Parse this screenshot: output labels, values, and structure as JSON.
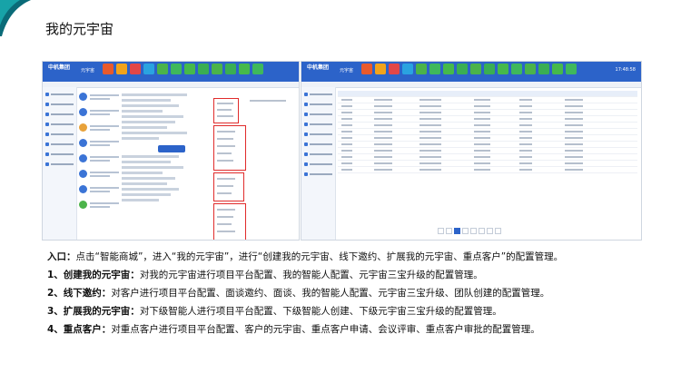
{
  "colors": {
    "topbar": "#2c63c9",
    "highlight": "#e02b2b",
    "accent": "#0a6b78"
  },
  "page": {
    "title": "我的元宇宙"
  },
  "screenshots": {
    "left": {
      "brand": "中机集团",
      "brand_small": "",
      "brand_sub": "元宇宙",
      "time": ""
    },
    "right": {
      "brand": "中机集团",
      "brand_small": "",
      "brand_sub": "元宇宙",
      "time": "17:48:58"
    }
  },
  "intro": {
    "line1_label": "入口：",
    "line1_text": "点击“智能商城”，进入“我的元宇宙”，进行“创建我的元宇宙、线下邀约、扩展我的元宇宙、重点客户”的配置管理。",
    "items": [
      {
        "label": "1、创建我的元宇宙：",
        "text": "对我的元宇宙进行项目平台配置、我的智能人配置、元宇宙三宝升级的配置管理。"
      },
      {
        "label": "2、线下邀约：",
        "text": "对客户进行项目平台配置、面谈邀约、面谈、我的智能人配置、元宇宙三宝升级、团队创建的配置管理。"
      },
      {
        "label": "3、扩展我的元宇宙：",
        "text": "对下级智能人进行项目平台配置、下级智能人创建、下级元宇宙三宝升级的配置管理。"
      },
      {
        "label": "4、重点客户：",
        "text": "对重点客户进行项目平台配置、客户的元宇宙、重点客户申请、会议评审、重点客户审批的配置管理。"
      }
    ]
  }
}
